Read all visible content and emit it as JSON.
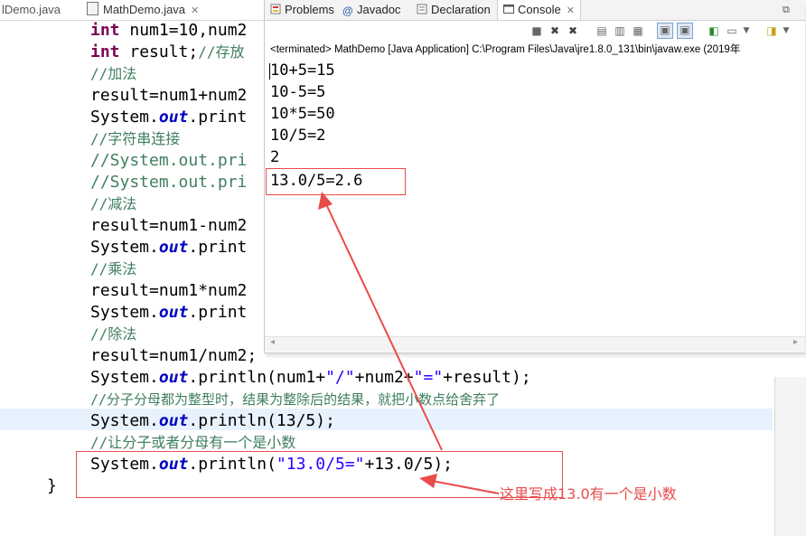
{
  "editor": {
    "tabs": [
      {
        "label": "lDemo.java"
      },
      {
        "label": "MathDemo.java",
        "close": "✕"
      }
    ]
  },
  "code": {
    "l1": {
      "kw": "int",
      "rest": " num1=10,num2"
    },
    "l2": {
      "kw": "int",
      "rest": " result;",
      "cmt": "//存放"
    },
    "l3": "//加法",
    "l4": "result=num1+num2",
    "l5": {
      "pre": "System.",
      "out": "out",
      "post": ".print"
    },
    "l6": "//字符串连接",
    "l7": "//System.out.pri",
    "l8": "//System.out.pri",
    "l9": "//减法",
    "l10": "result=num1-num2",
    "l11": {
      "pre": "System.",
      "out": "out",
      "post": ".print"
    },
    "l12": "//乘法",
    "l13": "result=num1*num2",
    "l14": {
      "pre": "System.",
      "out": "out",
      "post": ".print"
    },
    "l15": "//除法",
    "l16": "result=num1/num2;",
    "l17": {
      "pre": "System.",
      "out": "out",
      "a": ".println(num1+",
      "s1": "\"/\"",
      "b": "+num2+",
      "s2": "\"=\"",
      "c": "+result);"
    },
    "l18": "//分子分母都为整型时，结果为整除后的结果，就把小数点给舍弃了",
    "l19": {
      "pre": "System.",
      "out": "out",
      "post": ".println(13/5);"
    },
    "l20": "//让分子或者分母有一个是小数",
    "l21": {
      "pre": "System.",
      "out": "out",
      "a": ".println(",
      "s": "\"13.0/5=\"",
      "b": "+13.0/5);"
    },
    "l22": "}"
  },
  "console": {
    "tabs": [
      "Problems",
      "Javadoc",
      "Declaration",
      "Console"
    ],
    "active_tab": "Console",
    "close": "✕",
    "status": "<terminated> MathDemo [Java Application] C:\\Program Files\\Java\\jre1.8.0_131\\bin\\javaw.exe (2019年",
    "output": [
      "10+5=15",
      "10-5=5",
      "10*5=50",
      "10/5=2",
      "2",
      "13.0/5=2.6"
    ]
  },
  "annotation": {
    "text": "这里写成13.0有一个是小数",
    "color": "#e94b4b"
  },
  "colors": {
    "keyword": "#7f0055",
    "field": "#0000c0",
    "string": "#2a00ff",
    "comment": "#3f7f5f",
    "highlight_line": "#e8f2fe"
  }
}
